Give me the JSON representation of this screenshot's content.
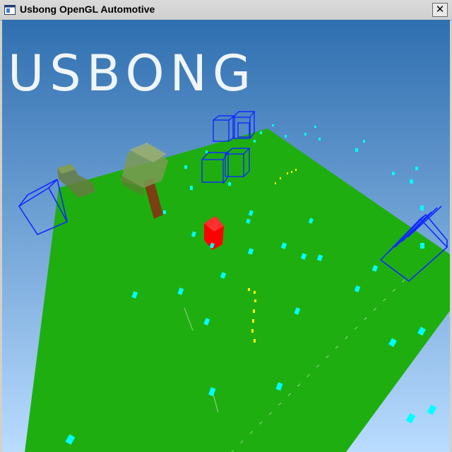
{
  "window": {
    "title": "Usbong OpenGL Automotive",
    "close_glyph": "✕",
    "icon": "opengl-window-icon"
  },
  "scene": {
    "overlay_title": "USBONG",
    "sky_colors": [
      "#2f6fb0",
      "#b9dcff"
    ],
    "ground_color": "#1fae10",
    "player_car_color": "#ff0000",
    "wireframe_color": "#1228ff",
    "pickup_color": "#00ffff",
    "marker_color": "#ffff00",
    "tree_trunk_color": "#7a3f13",
    "tree_leaves_color": "#6f9a3a"
  }
}
